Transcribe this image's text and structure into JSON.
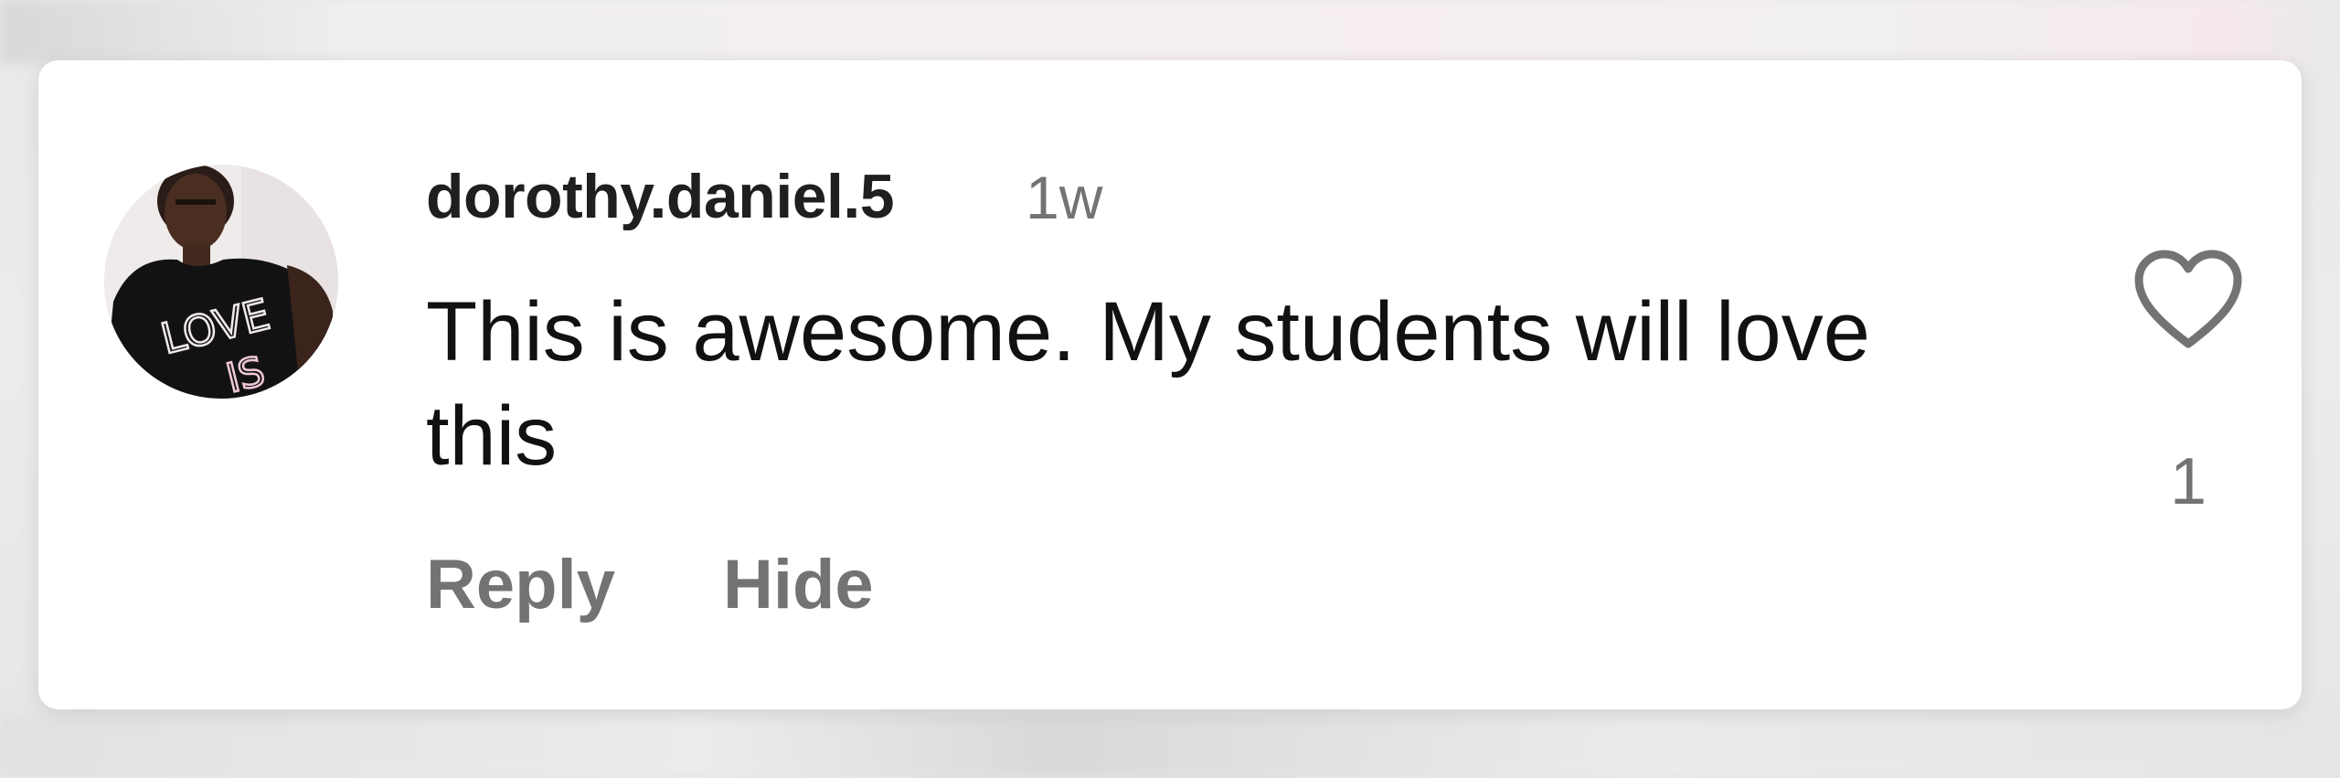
{
  "comment": {
    "username": "dorothy.daniel.5",
    "timestamp": "1w",
    "text": "This is awesome. My students will love this",
    "actions": {
      "reply_label": "Reply",
      "hide_label": "Hide"
    },
    "likes": {
      "icon": "heart-outline-icon",
      "count": "1"
    },
    "avatar": {
      "shirt_text_line1": "LOVE",
      "shirt_text_line2": "IS"
    }
  },
  "colors": {
    "card_background": "#ffffff",
    "primary_text": "#111111",
    "secondary_text": "#737373"
  }
}
